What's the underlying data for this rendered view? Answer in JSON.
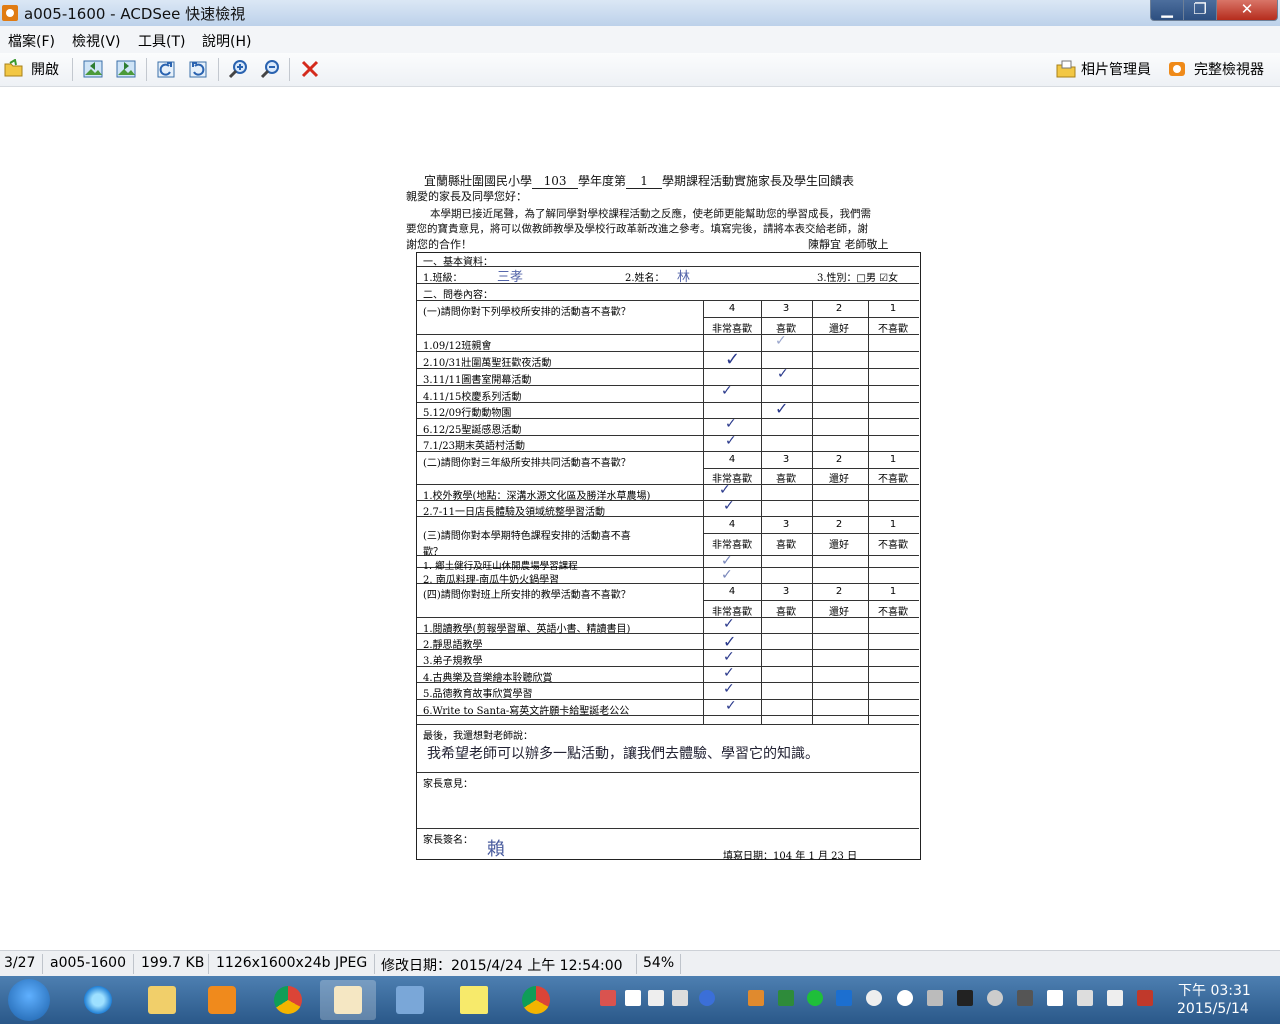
{
  "window": {
    "title": "a005-1600 - ACDSee 快速檢視",
    "min": "▁",
    "max": "❐",
    "close": "✕"
  },
  "menu": [
    {
      "label": "檔案(F)"
    },
    {
      "label": "檢視(V)"
    },
    {
      "label": "工具(T)"
    },
    {
      "label": "說明(H)"
    }
  ],
  "toolbar": {
    "open_label": "開啟",
    "photo_manager_label": "相片管理員",
    "full_viewer_label": "完整檢視器"
  },
  "document": {
    "title_prefix": "宜蘭縣壯圍國民小學",
    "year": "103",
    "title_mid": "學年度第",
    "term": "1",
    "title_suffix": "學期課程活動實施家長及學生回饋表",
    "greeting": "親愛的家長及同學您好：",
    "intro1": "本學期已接近尾聲，為了解同學對學校課程活動之反應，使老師更能幫助您的學習成長，我們需",
    "intro2": "要您的寶貴意見，將可以做教師教學及學校行政革新改進之參考。填寫完後，請將本表交給老師，謝",
    "intro3": "謝您的合作！",
    "signoff": "陳靜宜 老師敬上",
    "sec1": "一、基本資料：",
    "class_label": "1.班級：",
    "class_value": "三孝",
    "name_label": "2.姓名：",
    "name_value": "林",
    "gender_label": "3.性別：□男 ☑女",
    "sec2": "二、問卷內容：",
    "scale": [
      "4",
      "3",
      "2",
      "1"
    ],
    "scale_labels": [
      "非常喜歡",
      "喜歡",
      "還好",
      "不喜歡"
    ],
    "q1": "(一)請問你對下列學校所安排的活動喜不喜歡？",
    "q1_items": [
      "1.09/12班親會",
      "2.10/31壯圍萬聖狂歡夜活動",
      "3.11/11圖書室開幕活動",
      "4.11/15校慶系列活動",
      "5.12/09行動動物園",
      "6.12/25聖誕感恩活動",
      "7.1/23期末英語村活動"
    ],
    "q2": "(二)請問你對三年級所安排共同活動喜不喜歡？",
    "q2_items": [
      "1.校外教學(地點：深溝水源文化區及勝洋水草農場)",
      "2.7-11一日店長體驗及領域統整學習活動"
    ],
    "q3a": "(三)請問你對本學期特色課程安排的活動喜不喜",
    "q3b": "歡？",
    "q3_items": [
      "1. 鄉土健行及旺山休閒農場學習課程",
      "2. 南瓜料理-南瓜牛奶火鍋學習"
    ],
    "q4": "(四)請問你對班上所安排的教學活動喜不喜歡？",
    "q4_items": [
      "1.閱讀教學(剪報學習單、英語小書、精讀書目)",
      "2.靜思語教學",
      "3.弟子規教學",
      "4.古典樂及音樂繪本聆聽欣賞",
      "5.品德教育故事欣賞學習",
      "6.Write to Santa-寫英文許願卡給聖誕老公公"
    ],
    "check": "✓",
    "final_label": "最後，我還想對老師說：",
    "final_text": "我希望老師可以辦多一點活動，讓我們去體驗、學習它的知識。",
    "parent_opinion": "家長意見：",
    "parent_sign": "家長簽名：",
    "parent_sign_value": "賴",
    "fill_date": "填寫日期：104 年 1 月 23 日"
  },
  "status": {
    "index": "3/27",
    "filename": "a005-1600",
    "size": "199.7 KB",
    "dims": "1126x1600x24b JPEG",
    "modified": "修改日期：2015/4/24 上午 12:54:00",
    "zoom": "54%"
  },
  "taskbar": {
    "time": "下午 03:31",
    "date": "2015/5/14"
  },
  "colors": {
    "titlebar": "#c9daf0",
    "taskbar": "#2f5d90",
    "close": "#c2392b"
  }
}
